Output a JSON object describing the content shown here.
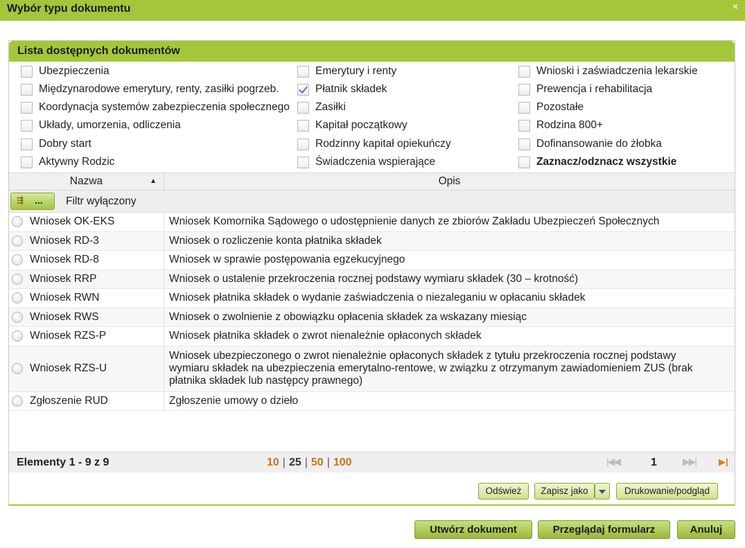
{
  "window": {
    "title": "Wybór typu dokumentu",
    "close_label": "×"
  },
  "panel": {
    "title": "Lista dostępnych dokumentów"
  },
  "categories": [
    {
      "label": "Ubezpieczenia",
      "checked": false
    },
    {
      "label": "Międzynarodowe emerytury, renty, zasiłki pogrzeb.",
      "checked": false
    },
    {
      "label": "Koordynacja systemów zabezpieczenia społecznego",
      "checked": false
    },
    {
      "label": "Układy, umorzenia, odliczenia",
      "checked": false
    },
    {
      "label": "Dobry start",
      "checked": false
    },
    {
      "label": "Aktywny Rodzic",
      "checked": false
    },
    {
      "label": "Emerytury i renty",
      "checked": false
    },
    {
      "label": "Płatnik składek",
      "checked": true
    },
    {
      "label": "Zasiłki",
      "checked": false
    },
    {
      "label": "Kapitał początkowy",
      "checked": false
    },
    {
      "label": "Rodzinny kapitał opiekuńczy",
      "checked": false
    },
    {
      "label": "Świadczenia wspierające",
      "checked": false
    },
    {
      "label": "Wnioski i zaświadczenia lekarskie",
      "checked": false
    },
    {
      "label": "Prewencja i rehabilitacja",
      "checked": false
    },
    {
      "label": "Pozostałe",
      "checked": false
    },
    {
      "label": "Rodzina 800+",
      "checked": false
    },
    {
      "label": "Dofinansowanie do żłobka",
      "checked": false
    },
    {
      "label": "Zaznacz/odznacz wszystkie",
      "checked": false
    }
  ],
  "grid": {
    "col_name": "Nazwa",
    "col_opis": "Opis",
    "sort_icon": "▲",
    "filter_button_label": "...",
    "filter_status": "Filtr wyłączony",
    "rows": [
      {
        "name": "Wniosek OK-EKS",
        "opis": "Wniosek Komornika Sądowego o udostępnienie danych ze zbiorów Zakładu Ubezpieczeń Społecznych"
      },
      {
        "name": "Wniosek RD-3",
        "opis": "Wniosek o rozliczenie konta płatnika składek"
      },
      {
        "name": "Wniosek RD-8",
        "opis": "Wniosek w sprawie postępowania egzekucyjnego"
      },
      {
        "name": "Wniosek RRP",
        "opis": "Wniosek o ustalenie przekroczenia rocznej podstawy wymiaru składek (30 – krotność)"
      },
      {
        "name": "Wniosek RWN",
        "opis": "Wniosek płatnika składek o wydanie zaświadczenia o niezaleganiu w opłacaniu składek"
      },
      {
        "name": "Wniosek RWS",
        "opis": "Wniosek o zwolnienie z obowiązku opłacenia składek za wskazany miesiąc"
      },
      {
        "name": "Wniosek RZS-P",
        "opis": "Wniosek płatnika składek o zwrot nienależnie opłaconych składek"
      },
      {
        "name": "Wniosek RZS-U",
        "opis": "Wniosek ubezpieczonego o zwrot nienależnie opłaconych składek z tytułu przekroczenia rocznej podstawy wymiaru składek na ubezpieczenia emerytalno-rentowe, w związku z otrzymanym zawiadomieniem ZUS (brak płatnika składek lub następcy prawnego)"
      },
      {
        "name": "Zgłoszenie RUD",
        "opis": "Zgłoszenie umowy o dzieło"
      }
    ]
  },
  "pager": {
    "elements": "Elementy 1 - 9 z 9",
    "sizes": [
      "10",
      "25",
      "50",
      "100"
    ],
    "current_size": "25",
    "page": "1",
    "first_icon": "|◀◀",
    "last_icon": "▶▶|",
    "last_page_icon": "▶|"
  },
  "toolbar": {
    "refresh": "Odśwież",
    "save_as": "Zapisz jako",
    "print": "Drukowanie/podgląd"
  },
  "actions": {
    "create": "Utwórz dokument",
    "browse": "Przeglądaj formularz",
    "cancel": "Anuluj"
  },
  "colors": {
    "accent": "#a5c63b",
    "link_orange": "#c8741a"
  }
}
